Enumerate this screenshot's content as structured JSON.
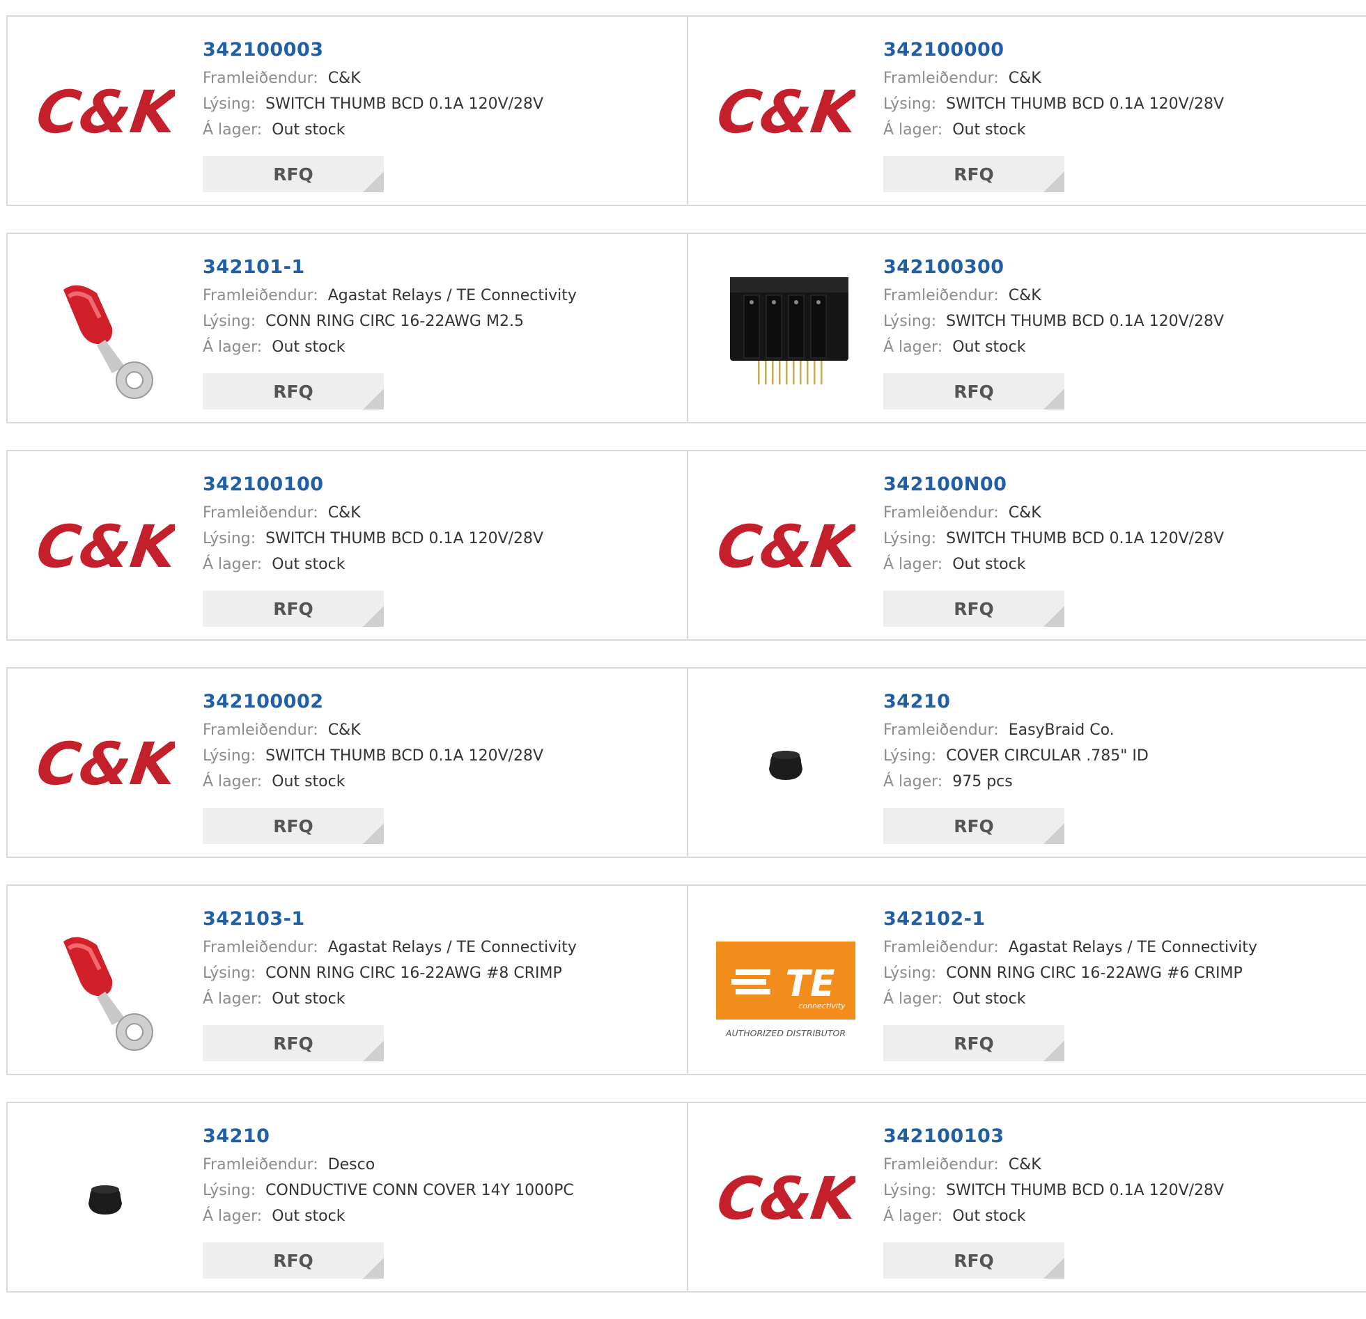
{
  "labels": {
    "manufacturer": "Framleiðendur:",
    "description": "Lýsing:",
    "stock": "Á lager:",
    "rfq": "RFQ"
  },
  "colors": {
    "link": "#1f5fa8",
    "ck_red": "#c3202b",
    "te_orange": "#f28c1b",
    "label_gray": "#8c8c8c"
  },
  "products": [
    {
      "part": "342100003",
      "manufacturer": "C&K",
      "description": "SWITCH THUMB BCD 0.1A 120V/28V",
      "stock": "Out stock",
      "image": "ck-logo"
    },
    {
      "part": "342100000",
      "manufacturer": "C&K",
      "description": "SWITCH THUMB BCD 0.1A 120V/28V",
      "stock": "Out stock",
      "image": "ck-logo"
    },
    {
      "part": "342101-1",
      "manufacturer": "Agastat Relays / TE Connectivity",
      "description": "CONN RING CIRC 16-22AWG M2.5",
      "stock": "Out stock",
      "image": "ring-terminal-photo"
    },
    {
      "part": "342100300",
      "manufacturer": "C&K",
      "description": "SWITCH THUMB BCD 0.1A 120V/28V",
      "stock": "Out stock",
      "image": "thumbwheel-switch-photo"
    },
    {
      "part": "342100100",
      "manufacturer": "C&K",
      "description": "SWITCH THUMB BCD 0.1A 120V/28V",
      "stock": "Out stock",
      "image": "ck-logo"
    },
    {
      "part": "342100N00",
      "manufacturer": "C&K",
      "description": "SWITCH THUMB BCD 0.1A 120V/28V",
      "stock": "Out stock",
      "image": "ck-logo"
    },
    {
      "part": "342100002",
      "manufacturer": "C&K",
      "description": "SWITCH THUMB BCD 0.1A 120V/28V",
      "stock": "Out stock",
      "image": "ck-logo"
    },
    {
      "part": "34210",
      "manufacturer": "EasyBraid Co.",
      "description": "COVER CIRCULAR .785\" ID",
      "stock": "975 pcs",
      "image": "black-cap-photo"
    },
    {
      "part": "342103-1",
      "manufacturer": "Agastat Relays / TE Connectivity",
      "description": "CONN RING CIRC 16-22AWG #8 CRIMP",
      "stock": "Out stock",
      "image": "ring-terminal-photo"
    },
    {
      "part": "342102-1",
      "manufacturer": "Agastat Relays / TE Connectivity",
      "description": "CONN RING CIRC 16-22AWG #6 CRIMP",
      "stock": "Out stock",
      "image": "te-logo"
    },
    {
      "part": "34210",
      "manufacturer": "Desco",
      "description": "CONDUCTIVE CONN COVER 14Y 1000PC",
      "stock": "Out stock",
      "image": "black-cap-photo"
    },
    {
      "part": "342100103",
      "manufacturer": "C&K",
      "description": "SWITCH THUMB BCD 0.1A 120V/28V",
      "stock": "Out stock",
      "image": "ck-logo"
    }
  ],
  "te_logo": {
    "text": "TE",
    "subtext": "connectivity",
    "caption": "AUTHORIZED DISTRIBUTOR"
  },
  "ck_logo": {
    "text": "C&K"
  }
}
